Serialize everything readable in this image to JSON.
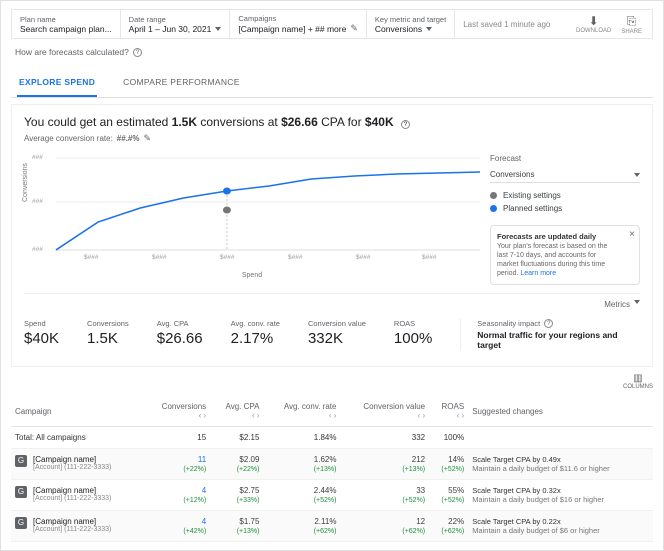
{
  "topbar": {
    "plan_label": "Plan name",
    "plan_value": "Search campaign plan...",
    "date_label": "Date range",
    "date_value": "April 1 – Jun 30, 2021",
    "camp_label": "Campaigns",
    "camp_value": "[Campaign name] + ## more",
    "metric_label": "Key metric and target",
    "metric_value": "Conversions",
    "saved": "Last saved 1 minute ago",
    "download_sub": "DOWNLOAD",
    "share_sub": "SHARE"
  },
  "calc_link": "How are forecasts calculated?",
  "tabs": {
    "explore": "EXPLORE SPEND",
    "compare": "COMPARE PERFORMANCE"
  },
  "headline": {
    "pre": "You could get an estimated ",
    "conv": "1.5K",
    "mid1": " conversions at ",
    "cpa": "$26.66",
    "mid2": " CPA for ",
    "spend": "$40K"
  },
  "avg_conv_label": "Average conversion rate: ",
  "avg_conv_value": "##.#%",
  "legend": {
    "title": "Forecast",
    "selected": "Conversions",
    "existing": "Existing settings",
    "planned": "Planned settings"
  },
  "notice": {
    "title": "Forecasts are updated daily",
    "body": "Your plan's forecast is based on the last 7-10 days, and accounts for market fluctuations during this time period.",
    "learn": "Learn more"
  },
  "metrics_label": "Metrics",
  "kpis": {
    "spend_l": "Spend",
    "spend_v": "$40K",
    "conv_l": "Conversions",
    "conv_v": "1.5K",
    "cpa_l": "Avg. CPA",
    "cpa_v": "$26.66",
    "rate_l": "Avg. conv. rate",
    "rate_v": "2.17%",
    "value_l": "Conversion value",
    "value_v": "332K",
    "roas_l": "ROAS",
    "roas_v": "100%",
    "season_l": "Seasonality impact",
    "season_desc": "Normal traffic for your regions and target"
  },
  "columns_label": "COLUMNS",
  "table": {
    "headers": {
      "campaign": "Campaign",
      "conversions": "Conversions",
      "avg_cpa": "Avg. CPA",
      "avg_rate": "Avg. conv. rate",
      "conv_value": "Conversion value",
      "roas": "ROAS",
      "suggested": "Suggested changes"
    },
    "total_label": "Total: All campaigns",
    "total": {
      "conversions": "15",
      "avg_cpa": "$2.15",
      "avg_rate": "1.84%",
      "conv_value": "332",
      "roas": "100%"
    },
    "rows": [
      {
        "name": "[Campaign name]",
        "account": "[Account] (111-222-3333)",
        "conversions": "11",
        "conversions_d": "(+22%)",
        "avg_cpa": "$2.09",
        "avg_cpa_d": "(+22%)",
        "avg_rate": "1.62%",
        "avg_rate_d": "(+13%)",
        "conv_value": "212",
        "conv_value_d": "(+13%)",
        "roas": "14%",
        "roas_d": "(+52%)",
        "sugg1": "Scale Target CPA by 0.49x",
        "sugg2": "Maintain a daily budget of $11.6 or higher"
      },
      {
        "name": "[Campaign name]",
        "account": "[Account] (111-222-3333)",
        "conversions": "4",
        "conversions_d": "(+12%)",
        "avg_cpa": "$2.75",
        "avg_cpa_d": "(+33%)",
        "avg_rate": "2.44%",
        "avg_rate_d": "(+52%)",
        "conv_value": "33",
        "conv_value_d": "(+52%)",
        "roas": "55%",
        "roas_d": "(+52%)",
        "sugg1": "Scale Target CPA by 0.32x",
        "sugg2": "Maintain a daily budget of $16 or higher"
      },
      {
        "name": "[Campaign name]",
        "account": "[Account] (111-222-3333)",
        "conversions": "4",
        "conversions_d": "(+42%)",
        "avg_cpa": "$1.75",
        "avg_cpa_d": "(+13%)",
        "avg_rate": "2.11%",
        "avg_rate_d": "(+62%)",
        "conv_value": "12",
        "conv_value_d": "(+62%)",
        "roas": "22%",
        "roas_d": "(+62%)",
        "sugg1": "Scale Target CPA by 0.22x",
        "sugg2": "Maintain a daily budget of $6 or higher"
      }
    ]
  },
  "chart_data": {
    "type": "line",
    "xlabel": "Spend",
    "ylabel": "Conversions",
    "x_ticks": [
      "$###",
      "$###",
      "$###",
      "$###",
      "$###",
      "$###"
    ],
    "y_ticks": [
      "###",
      "###",
      "###"
    ],
    "series": [
      {
        "name": "Conversions",
        "points_norm": [
          [
            0,
            0.85
          ],
          [
            0.1,
            0.6
          ],
          [
            0.2,
            0.48
          ],
          [
            0.3,
            0.4
          ],
          [
            0.4,
            0.34
          ],
          [
            0.5,
            0.3
          ],
          [
            0.6,
            0.24
          ],
          [
            0.7,
            0.22
          ],
          [
            0.8,
            0.2
          ],
          [
            0.9,
            0.19
          ],
          [
            1.0,
            0.18
          ]
        ]
      }
    ],
    "markers": {
      "existing": {
        "x_norm": 0.4,
        "y_norm": 0.5
      },
      "planned": {
        "x_norm": 0.4,
        "y_norm": 0.34
      }
    }
  }
}
